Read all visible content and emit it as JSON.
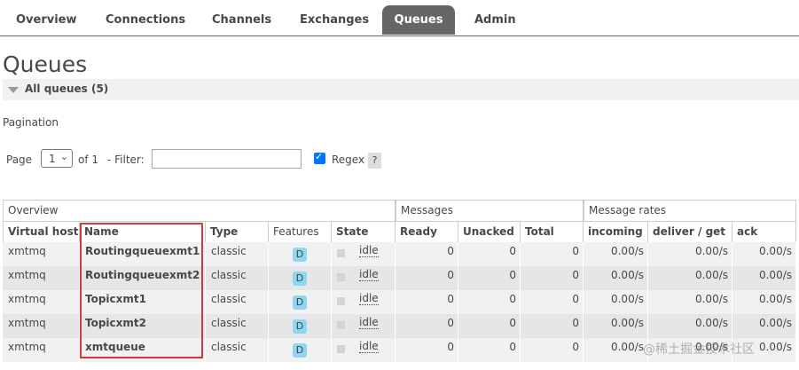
{
  "tabs": [
    {
      "label": "Overview"
    },
    {
      "label": "Connections"
    },
    {
      "label": "Channels"
    },
    {
      "label": "Exchanges"
    },
    {
      "label": "Queues",
      "active": true
    },
    {
      "label": "Admin"
    }
  ],
  "page_title": "Queues",
  "section": {
    "label": "All queues (5)"
  },
  "pagination": {
    "label": "Pagination",
    "page_label": "Page",
    "page_value": "1",
    "of_label": "of 1",
    "filter_label": "- Filter:",
    "filter_value": "",
    "regex_label": "Regex",
    "regex_checked": true,
    "help_label": "?"
  },
  "table": {
    "groups": [
      "Overview",
      "Messages",
      "Message rates"
    ],
    "headers": [
      "Virtual host",
      "Name",
      "Type",
      "Features",
      "State",
      "Ready",
      "Unacked",
      "Total",
      "incoming",
      "deliver / get",
      "ack"
    ],
    "rows": [
      {
        "vhost": "xmtmq",
        "name": "Routingqueuexmt1",
        "type": "classic",
        "feature": "D",
        "state": "idle",
        "ready": "0",
        "unacked": "0",
        "total": "0",
        "incoming": "0.00/s",
        "deliver": "0.00/s",
        "ack": "0.00/s"
      },
      {
        "vhost": "xmtmq",
        "name": "Routingqueuexmt2",
        "type": "classic",
        "feature": "D",
        "state": "idle",
        "ready": "0",
        "unacked": "0",
        "total": "0",
        "incoming": "0.00/s",
        "deliver": "0.00/s",
        "ack": "0.00/s"
      },
      {
        "vhost": "xmtmq",
        "name": "Topicxmt1",
        "type": "classic",
        "feature": "D",
        "state": "idle",
        "ready": "0",
        "unacked": "0",
        "total": "0",
        "incoming": "0.00/s",
        "deliver": "0.00/s",
        "ack": "0.00/s"
      },
      {
        "vhost": "xmtmq",
        "name": "Topicxmt2",
        "type": "classic",
        "feature": "D",
        "state": "idle",
        "ready": "0",
        "unacked": "0",
        "total": "0",
        "incoming": "0.00/s",
        "deliver": "0.00/s",
        "ack": "0.00/s"
      },
      {
        "vhost": "xmtmq",
        "name": "xmtqueue",
        "type": "classic",
        "feature": "D",
        "state": "idle",
        "ready": "0",
        "unacked": "0",
        "total": "0",
        "incoming": "0.00/s",
        "deliver": "0.00/s",
        "ack": "0.00/s"
      }
    ]
  },
  "watermark": "@稀土掘金技术社区",
  "colors": {
    "active_tab": "#666666",
    "feature_badge": "#8fd6f0",
    "highlight_box": "#d9363e",
    "checkbox": "#0075ff"
  }
}
